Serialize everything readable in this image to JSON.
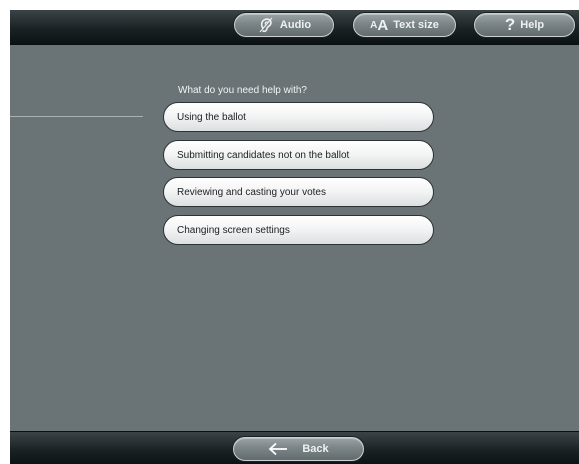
{
  "toolbar": {
    "audio_label": "Audio",
    "text_size_prefix_small": "A",
    "text_size_prefix_big": "A",
    "text_size_label": "Text size",
    "help_symbol": "?",
    "help_label": "Help"
  },
  "main": {
    "prompt": "What do you need help with?",
    "options": [
      {
        "label": "Using the ballot"
      },
      {
        "label": "Submitting candidates not on the ballot"
      },
      {
        "label": "Reviewing and casting your votes"
      },
      {
        "label": "Changing screen settings"
      }
    ]
  },
  "footer": {
    "back_label": "Back"
  },
  "icons": {
    "audio": "ear-icon",
    "help": "question-mark-icon",
    "back": "left-arrow-icon"
  },
  "colors": {
    "background": "#6a7476",
    "bar": "#1a2224",
    "option_button": "#f2f3f3"
  }
}
